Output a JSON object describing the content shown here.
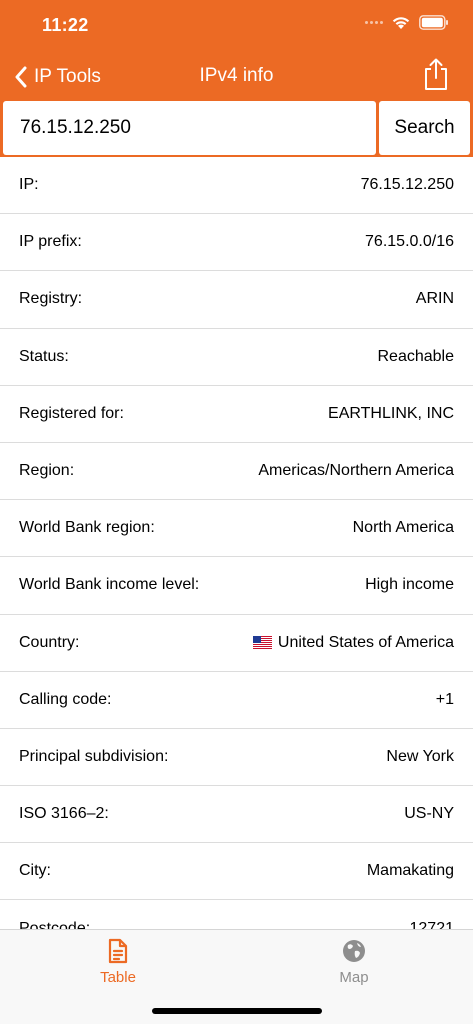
{
  "status_bar": {
    "time": "11:22"
  },
  "nav": {
    "back_label": "IP Tools",
    "title": "IPv4 info"
  },
  "search": {
    "value": "76.15.12.250",
    "button_label": "Search"
  },
  "rows": [
    {
      "label": "IP:",
      "value": "76.15.12.250"
    },
    {
      "label": "IP prefix:",
      "value": "76.15.0.0/16"
    },
    {
      "label": "Registry:",
      "value": "ARIN"
    },
    {
      "label": "Status:",
      "value": "Reachable"
    },
    {
      "label": "Registered for:",
      "value": "EARTHLINK, INC"
    },
    {
      "label": "Region:",
      "value": "Americas/Northern America"
    },
    {
      "label": "World Bank region:",
      "value": "North America"
    },
    {
      "label": "World Bank income level:",
      "value": "High income"
    },
    {
      "label": "Country:",
      "value": "United States of America",
      "icon": "us-flag-icon"
    },
    {
      "label": "Calling code:",
      "value": "+1"
    },
    {
      "label": "Principal subdivision:",
      "value": "New York"
    },
    {
      "label": "ISO 3166–2:",
      "value": "US-NY"
    },
    {
      "label": "City:",
      "value": "Mamakating"
    },
    {
      "label": "Postcode:",
      "value": "12721"
    }
  ],
  "tabs": [
    {
      "label": "Table",
      "icon": "document-icon",
      "selected": true
    },
    {
      "label": "Map",
      "icon": "globe-icon",
      "selected": false
    }
  ],
  "colors": {
    "accent": "#EC6A24",
    "tab_inactive": "#8e8e8e",
    "separator": "#dcdcdc"
  }
}
